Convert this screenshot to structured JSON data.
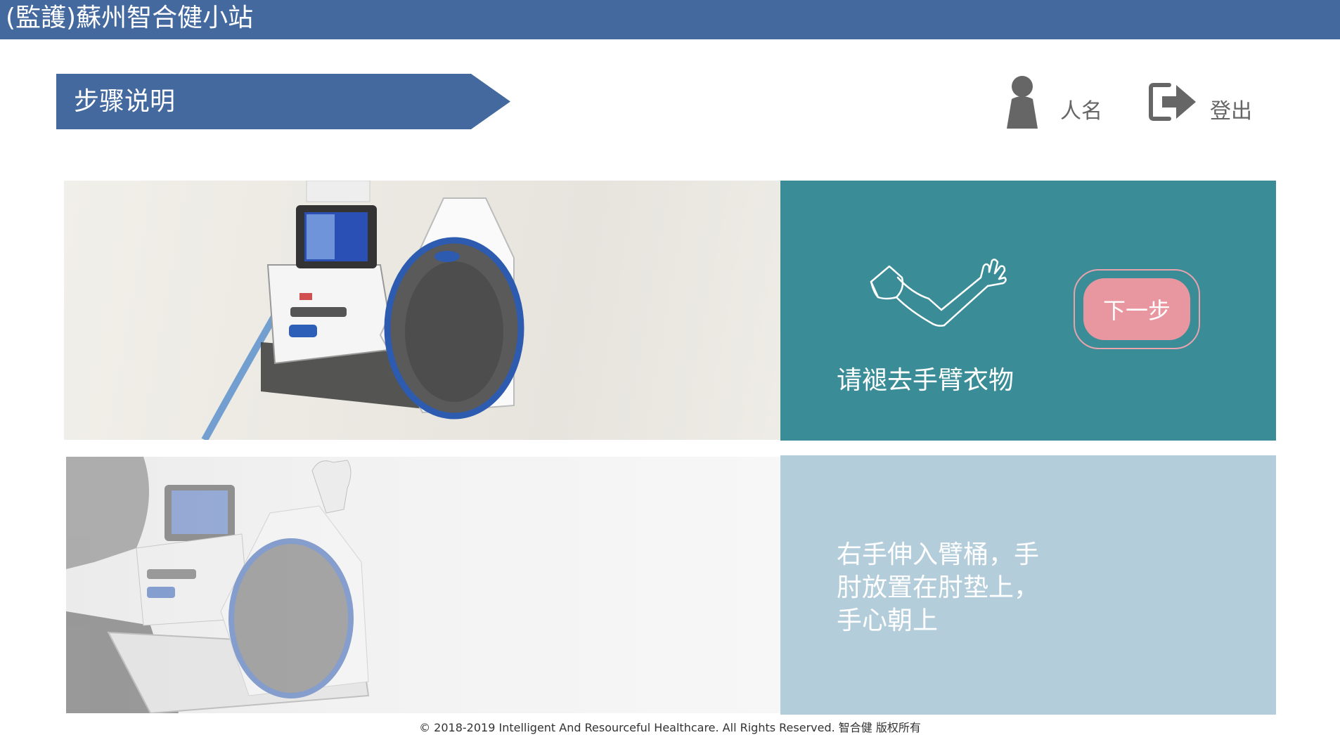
{
  "header": {
    "title": "(監護)蘇州智合健小站"
  },
  "step_banner": {
    "label": "步骤说明"
  },
  "user": {
    "icon": "person-icon",
    "name": "人名"
  },
  "logout": {
    "icon": "logout-icon",
    "label": "登出"
  },
  "steps": [
    {
      "icon": "arm-icon",
      "instruction": "请褪去手臂衣物",
      "next_label": "下一步",
      "color": "#3a8d97"
    },
    {
      "instruction": "右手伸入臂桶，手肘放置在肘垫上，手心朝上",
      "color": "#b4cddb"
    }
  ],
  "colors": {
    "header": "#44699e",
    "next_button": "#e8969f"
  },
  "footer": {
    "copyright": "© 2018-2019 Intelligent And Resourceful Healthcare. All Rights Reserved. 智合健 版权所有"
  }
}
